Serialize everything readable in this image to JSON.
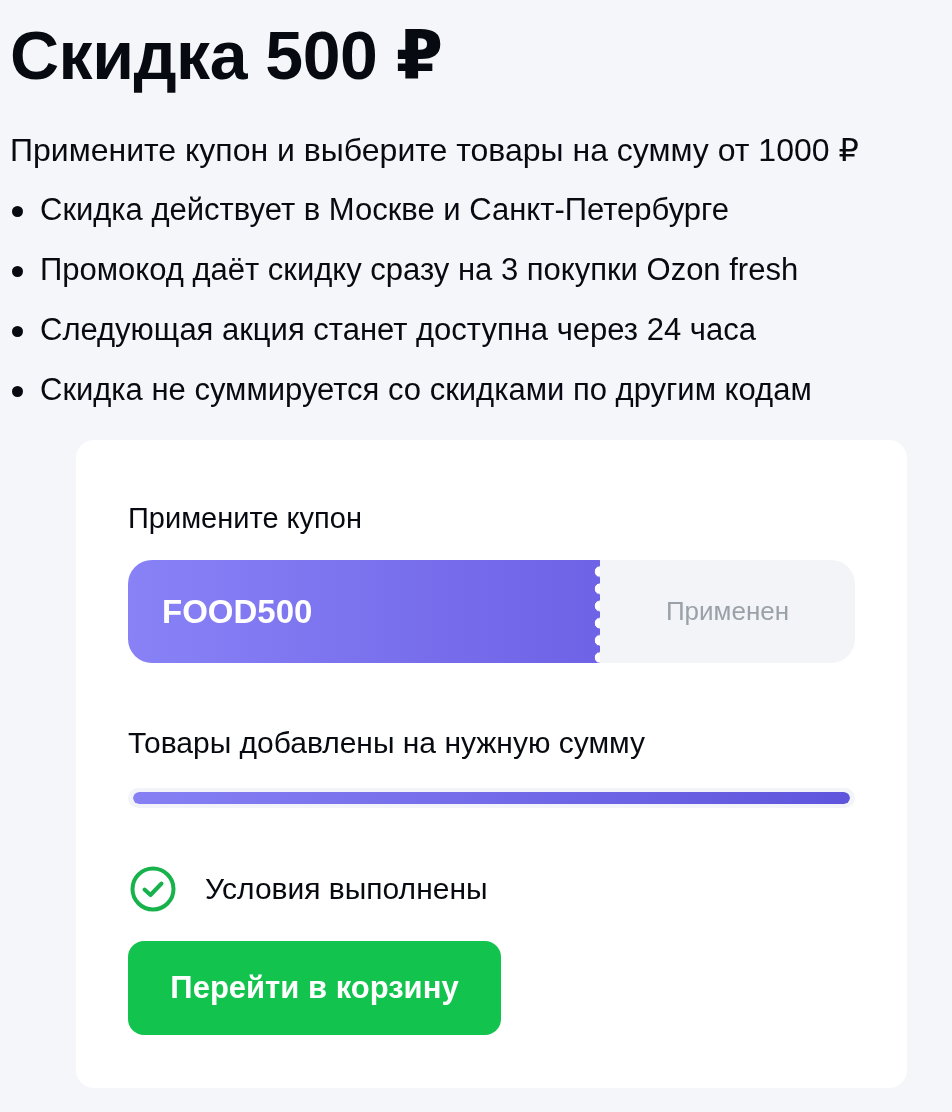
{
  "header": {
    "title": "Скидка 500 ₽",
    "subtitle": "Примените купон и выберите товары на сумму от 1000 ₽",
    "conditions": [
      "Скидка действует в Москве и Санкт-Петербурге",
      "Промокод даёт скидку сразу на 3 покупки Ozon fresh",
      "Следующая акция станет доступна через 24 часа",
      "Скидка не суммируется со скидками по другим кодам"
    ]
  },
  "coupon_card": {
    "coupon_label": "Примените купон",
    "coupon": {
      "code": "FOOD500",
      "apply_button": "Применен",
      "disabled": true
    },
    "progress": {
      "label": "Товары добавлены на нужную сумму",
      "level": 1
    },
    "conditions_status": {
      "text": "Условия выполнены",
      "met": true
    },
    "button": "Перейти в корзину"
  }
}
